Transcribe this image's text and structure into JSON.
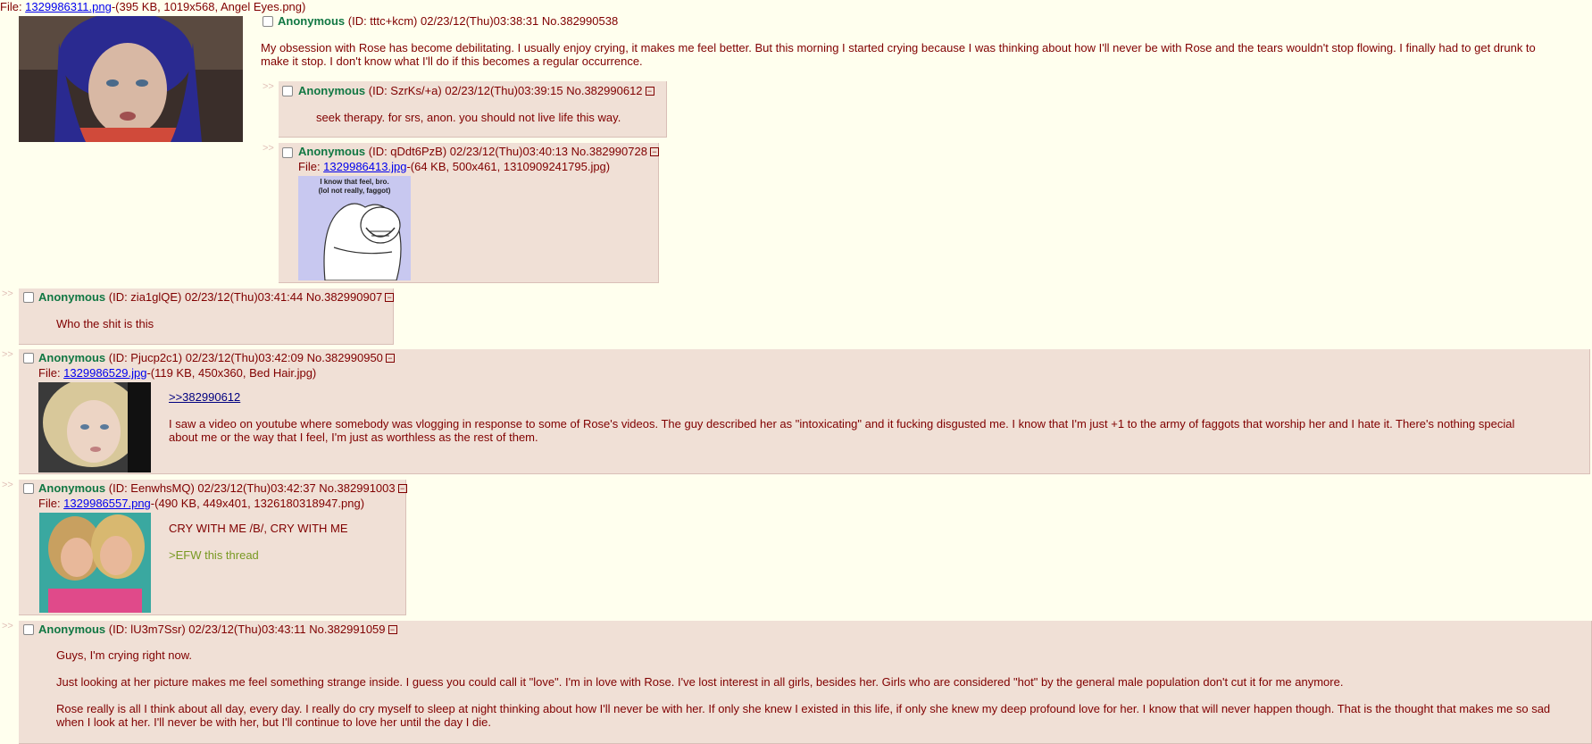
{
  "op": {
    "file_prefix": "File: ",
    "file_link": "1329986311.png",
    "file_info": "-(395 KB, 1019x568, Angel Eyes.png)",
    "name": "Anonymous",
    "meta": "(ID: tttc+kcm) 02/23/12(Thu)03:38:31 No.382990538",
    "body": "My obsession with Rose has become debilitating. I usually enjoy crying, it makes me feel better. But this morning I started crying because I was thinking about how I'll never be with Rose and the tears wouldn't stop flowing. I finally had to get drunk to make it stop. I don't know what I'll do if this becomes a regular occurrence."
  },
  "arrows": ">>",
  "minus_glyph": "−",
  "replies": [
    {
      "name": "Anonymous",
      "meta": "(ID: SzrKs/+a) 02/23/12(Thu)03:39:15 No.382990612",
      "body": "seek therapy. for srs, anon. you should not live life this way."
    },
    {
      "name": "Anonymous",
      "meta": "(ID: qDdt6PzB) 02/23/12(Thu)03:40:13 No.382990728",
      "file_prefix": "File: ",
      "file_link": "1329986413.jpg",
      "file_info": "-(64 KB, 500x461, 1310909241795.jpg)",
      "image_caption_1": "I know that feel, bro.",
      "image_caption_2": "(lol not really, faggot)"
    },
    {
      "name": "Anonymous",
      "meta": "(ID: zia1glQE) 02/23/12(Thu)03:41:44 No.382990907",
      "body": "Who the shit is this"
    },
    {
      "name": "Anonymous",
      "meta": "(ID: Pjucp2c1) 02/23/12(Thu)03:42:09 No.382990950",
      "file_prefix": "File: ",
      "file_link": "1329986529.jpg",
      "file_info": "-(119 KB, 450x360, Bed Hair.jpg)",
      "quotelink": ">>382990612",
      "body": "I saw a video on youtube where somebody was vlogging in response to some of Rose's videos. The guy described her as \"intoxicating\" and it fucking disgusted me. I know that I'm just +1 to the army of faggots that worship her and I hate it. There's nothing special about me or the way that I feel, I'm just as worthless as the rest of them."
    },
    {
      "name": "Anonymous",
      "meta": "(ID: EenwhsMQ) 02/23/12(Thu)03:42:37 No.382991003",
      "file_prefix": "File: ",
      "file_link": "1329986557.png",
      "file_info": "-(490 KB, 449x401, 1326180318947.png)",
      "body": "CRY WITH ME /B/, CRY WITH ME",
      "greentext": ">EFW this thread"
    },
    {
      "name": "Anonymous",
      "meta": "(ID: lU3m7Ssr) 02/23/12(Thu)03:43:11 No.382991059",
      "para1": "Guys, I'm crying right now.",
      "para2": "Just looking at her picture makes me feel something strange inside. I guess you could call it \"love\". I'm in love with Rose. I've lost interest in all girls, besides her. Girls who are considered \"hot\" by the general male population don't cut it for me anymore.",
      "para3": "Rose really is all I think about all day, every day. I really do cry myself to sleep at night thinking about how I'll never be with her. If only she knew I existed in this life, if only she knew my deep profound love for her. I know that will never happen though. That is the thought that makes me so sad when I look at her. I'll never be with her, but I'll continue to love her until the day I die."
    }
  ]
}
